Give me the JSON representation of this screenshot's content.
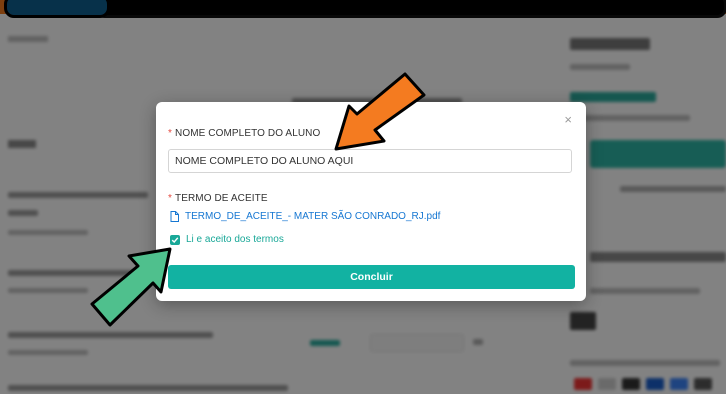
{
  "modal": {
    "close_symbol": "×",
    "name_field": {
      "required_mark": "*",
      "label": "NOME COMPLETO DO ALUNO",
      "value": "NOME COMPLETO DO ALUNO AQUI"
    },
    "terms_field": {
      "required_mark": "*",
      "label": "TERMO DE ACEITE",
      "file_name": "TERMO_DE_ACEITE_- MATER SÃO CONRADO_RJ.pdf",
      "file_icon": "document-icon"
    },
    "agree_checkbox": {
      "checked": true,
      "label": "Li e aceito dos termos"
    },
    "submit_label": "Concluir"
  },
  "annotations": {
    "orange_arrow_color": "#f47b20",
    "green_arrow_color": "#4fc08d"
  },
  "colors": {
    "accent_teal": "#12b2a2",
    "link_blue": "#1677d2",
    "required_red": "#e5483e",
    "header_orange": "#f07a1e"
  }
}
